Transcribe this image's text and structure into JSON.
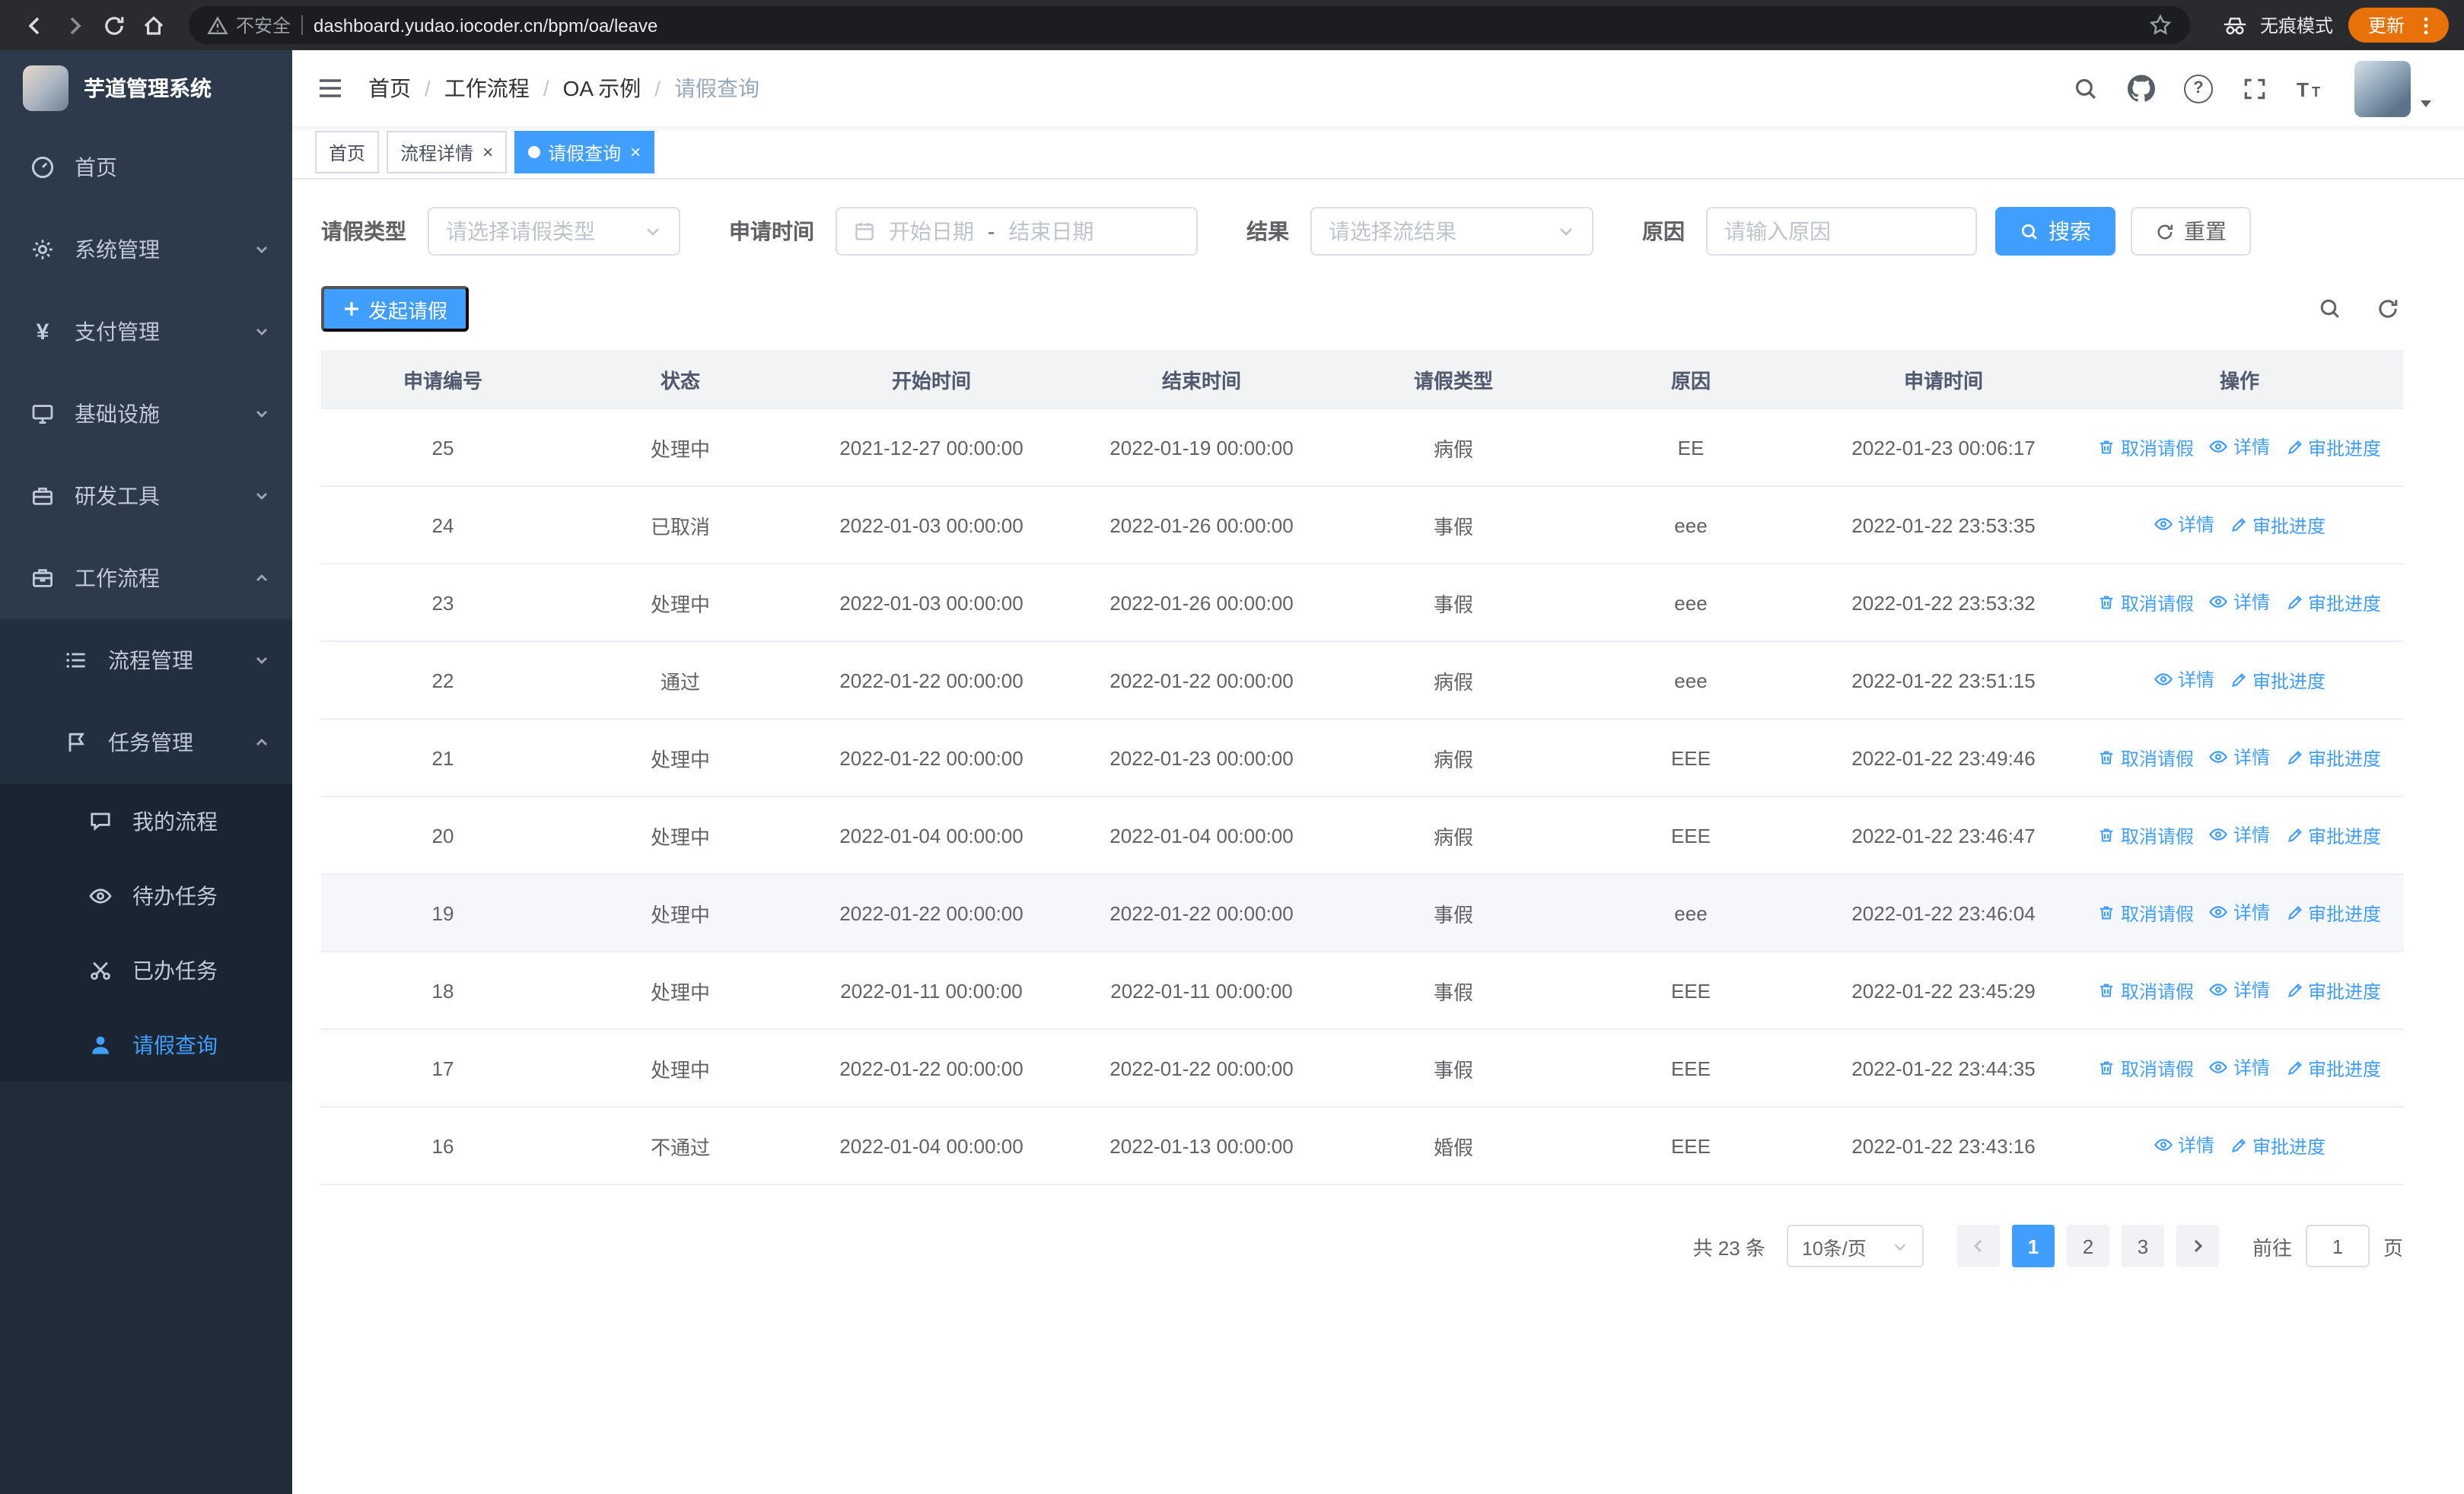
{
  "browser": {
    "security_label": "不安全",
    "url": "dashboard.yudao.iocoder.cn/bpm/oa/leave",
    "incognito_label": "无痕模式",
    "update_label": "更新"
  },
  "sidebar": {
    "app_title": "芋道管理系统",
    "home": "首页",
    "system": "系统管理",
    "payment": "支付管理",
    "infra": "基础设施",
    "devtools": "研发工具",
    "workflow": "工作流程",
    "process_mgmt": "流程管理",
    "task_mgmt": "任务管理",
    "my_process": "我的流程",
    "todo": "待办任务",
    "done": "已办任务",
    "leave_query": "请假查询"
  },
  "breadcrumb": {
    "items": [
      "首页",
      "工作流程",
      "OA 示例",
      "请假查询"
    ]
  },
  "tabs": [
    {
      "label": "首页"
    },
    {
      "label": "流程详情"
    },
    {
      "label": "请假查询"
    }
  ],
  "filters": {
    "leave_type_label": "请假类型",
    "leave_type_placeholder": "请选择请假类型",
    "apply_time_label": "申请时间",
    "start_date_placeholder": "开始日期",
    "date_separator": "-",
    "end_date_placeholder": "结束日期",
    "result_label": "结果",
    "result_placeholder": "请选择流结果",
    "reason_label": "原因",
    "reason_placeholder": "请输入原因",
    "search_button": "搜索",
    "reset_button": "重置"
  },
  "toolbar": {
    "create_button": "发起请假"
  },
  "table": {
    "columns": [
      "申请编号",
      "状态",
      "开始时间",
      "结束时间",
      "请假类型",
      "原因",
      "申请时间",
      "操作"
    ],
    "action_labels": {
      "cancel": "取消请假",
      "detail": "详情",
      "progress": "审批进度"
    },
    "rows": [
      {
        "id": "25",
        "status": "处理中",
        "start": "2021-12-27 00:00:00",
        "end": "2022-01-19 00:00:00",
        "type": "病假",
        "reason": "EE",
        "applied": "2022-01-23 00:06:17",
        "actions": [
          "cancel",
          "detail",
          "progress"
        ]
      },
      {
        "id": "24",
        "status": "已取消",
        "start": "2022-01-03 00:00:00",
        "end": "2022-01-26 00:00:00",
        "type": "事假",
        "reason": "eee",
        "applied": "2022-01-22 23:53:35",
        "actions": [
          "detail",
          "progress"
        ]
      },
      {
        "id": "23",
        "status": "处理中",
        "start": "2022-01-03 00:00:00",
        "end": "2022-01-26 00:00:00",
        "type": "事假",
        "reason": "eee",
        "applied": "2022-01-22 23:53:32",
        "actions": [
          "cancel",
          "detail",
          "progress"
        ]
      },
      {
        "id": "22",
        "status": "通过",
        "start": "2022-01-22 00:00:00",
        "end": "2022-01-22 00:00:00",
        "type": "病假",
        "reason": "eee",
        "applied": "2022-01-22 23:51:15",
        "actions": [
          "detail",
          "progress"
        ]
      },
      {
        "id": "21",
        "status": "处理中",
        "start": "2022-01-22 00:00:00",
        "end": "2022-01-23 00:00:00",
        "type": "病假",
        "reason": "EEE",
        "applied": "2022-01-22 23:49:46",
        "actions": [
          "cancel",
          "detail",
          "progress"
        ]
      },
      {
        "id": "20",
        "status": "处理中",
        "start": "2022-01-04 00:00:00",
        "end": "2022-01-04 00:00:00",
        "type": "病假",
        "reason": "EEE",
        "applied": "2022-01-22 23:46:47",
        "actions": [
          "cancel",
          "detail",
          "progress"
        ]
      },
      {
        "id": "19",
        "status": "处理中",
        "start": "2022-01-22 00:00:00",
        "end": "2022-01-22 00:00:00",
        "type": "事假",
        "reason": "eee",
        "applied": "2022-01-22 23:46:04",
        "actions": [
          "cancel",
          "detail",
          "progress"
        ],
        "hover": true
      },
      {
        "id": "18",
        "status": "处理中",
        "start": "2022-01-11 00:00:00",
        "end": "2022-01-11 00:00:00",
        "type": "事假",
        "reason": "EEE",
        "applied": "2022-01-22 23:45:29",
        "actions": [
          "cancel",
          "detail",
          "progress"
        ]
      },
      {
        "id": "17",
        "status": "处理中",
        "start": "2022-01-22 00:00:00",
        "end": "2022-01-22 00:00:00",
        "type": "事假",
        "reason": "EEE",
        "applied": "2022-01-22 23:44:35",
        "actions": [
          "cancel",
          "detail",
          "progress"
        ]
      },
      {
        "id": "16",
        "status": "不通过",
        "start": "2022-01-04 00:00:00",
        "end": "2022-01-13 00:00:00",
        "type": "婚假",
        "reason": "EEE",
        "applied": "2022-01-22 23:43:16",
        "actions": [
          "detail",
          "progress"
        ]
      }
    ]
  },
  "pagination": {
    "total": "共 23 条",
    "page_size": "10条/页",
    "pages": [
      "1",
      "2",
      "3"
    ],
    "active_page": "1",
    "goto_label": "前往",
    "goto_value": "1",
    "goto_suffix": "页"
  },
  "colors": {
    "primary": "#409EFF",
    "sidebar_bg": "#2c3a4c",
    "submenu_bg": "#222f3f",
    "nested_submenu_bg": "#1a2531",
    "update_pill": "#e8710a",
    "table_header_bg": "#f2f3f5"
  }
}
